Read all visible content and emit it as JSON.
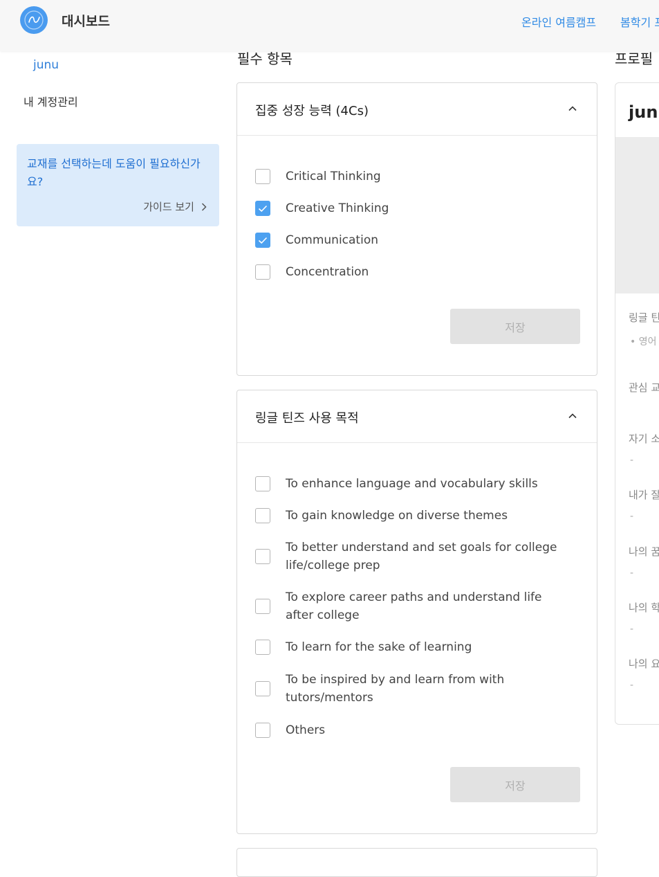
{
  "header": {
    "brand": "대시보드",
    "nav": [
      "온라인 여름캠프",
      "봄학기 프"
    ]
  },
  "sidebar": {
    "user": "junu",
    "account": "내 계정관리",
    "guide": {
      "text": "교재를 선택하는데 도움이 필요하신가요?",
      "link": "가이드 보기"
    }
  },
  "main": {
    "title": "필수 항목"
  },
  "card1": {
    "title": "집중 성장 능력 (4Cs)",
    "options": [
      {
        "label": "Critical Thinking",
        "checked": false
      },
      {
        "label": "Creative Thinking",
        "checked": true
      },
      {
        "label": "Communication",
        "checked": true
      },
      {
        "label": "Concentration",
        "checked": false
      }
    ],
    "save": "저장"
  },
  "card2": {
    "title": "링글 틴즈 사용 목적",
    "options": [
      {
        "label": "To enhance language and vocabulary skills",
        "checked": false
      },
      {
        "label": "To gain knowledge on diverse themes",
        "checked": false
      },
      {
        "label": "To better understand and set goals for college life/college prep",
        "checked": false
      },
      {
        "label": "To explore career paths and understand life after college",
        "checked": false
      },
      {
        "label": "To learn for the sake of learning",
        "checked": false
      },
      {
        "label": "To be inspired by and learn from with tutors/mentors",
        "checked": false
      },
      {
        "label": "Others",
        "checked": false
      }
    ],
    "save": "저장"
  },
  "profile": {
    "title": "프로필",
    "name": "junu",
    "labels": [
      "링글 틴",
      "• 영어",
      "관심 교",
      "자기 소",
      "-",
      "내가 잘",
      "-",
      "나의 꿈",
      "-",
      "나의 학",
      "-",
      "나의 요",
      "-"
    ]
  },
  "colors": {
    "accent": "#4da1f0",
    "link": "#2f8ae5",
    "guide_bg": "#dcebfb"
  }
}
